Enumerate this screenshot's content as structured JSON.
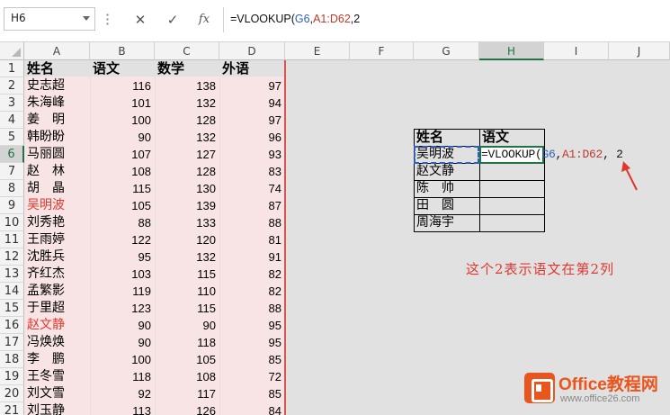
{
  "formula_bar": {
    "name_box": "H6",
    "cancel_glyph": "✕",
    "enter_glyph": "✓",
    "fx_label": "fx",
    "formula_prefix": "=VLOOKUP(",
    "formula_ref1": "G6",
    "formula_sep": ",",
    "formula_ref2": "A1:D62",
    "formula_suffix": ",2"
  },
  "columns": [
    "A",
    "B",
    "C",
    "D",
    "E",
    "F",
    "G",
    "H",
    "I",
    "J"
  ],
  "rows": [
    "1",
    "2",
    "3",
    "4",
    "5",
    "6",
    "7",
    "8",
    "9",
    "10",
    "11",
    "12",
    "13",
    "14",
    "15",
    "16",
    "17",
    "18",
    "19",
    "20",
    "21"
  ],
  "active_cell": {
    "col": "H",
    "row": "6"
  },
  "main_table": {
    "headers": [
      "姓名",
      "语文",
      "数学",
      "外语"
    ],
    "records": [
      {
        "name": "史志超",
        "yw": "116",
        "sx": "138",
        "wy": "97"
      },
      {
        "name": "朱海峰",
        "yw": "101",
        "sx": "132",
        "wy": "94"
      },
      {
        "name": "姜　明",
        "yw": "100",
        "sx": "128",
        "wy": "97"
      },
      {
        "name": "韩盼盼",
        "yw": "90",
        "sx": "132",
        "wy": "96"
      },
      {
        "name": "马丽圆",
        "yw": "107",
        "sx": "127",
        "wy": "93"
      },
      {
        "name": "赵　林",
        "yw": "108",
        "sx": "128",
        "wy": "83"
      },
      {
        "name": "胡　晶",
        "yw": "115",
        "sx": "130",
        "wy": "74"
      },
      {
        "name": "吴明波",
        "yw": "105",
        "sx": "139",
        "wy": "87"
      },
      {
        "name": "刘秀艳",
        "yw": "88",
        "sx": "133",
        "wy": "88"
      },
      {
        "name": "王雨婷",
        "yw": "122",
        "sx": "120",
        "wy": "81"
      },
      {
        "name": "沈胜兵",
        "yw": "95",
        "sx": "132",
        "wy": "91"
      },
      {
        "name": "齐红杰",
        "yw": "103",
        "sx": "115",
        "wy": "82"
      },
      {
        "name": "孟繁影",
        "yw": "119",
        "sx": "110",
        "wy": "82"
      },
      {
        "name": "于里超",
        "yw": "123",
        "sx": "115",
        "wy": "88"
      },
      {
        "name": "赵文静",
        "yw": "90",
        "sx": "90",
        "wy": "95"
      },
      {
        "name": "冯焕焕",
        "yw": "90",
        "sx": "118",
        "wy": "95"
      },
      {
        "name": "李　鹏",
        "yw": "100",
        "sx": "105",
        "wy": "85"
      },
      {
        "name": "王冬雪",
        "yw": "118",
        "sx": "108",
        "wy": "72"
      },
      {
        "name": "刘文雪",
        "yw": "92",
        "sx": "117",
        "wy": "85"
      },
      {
        "name": "刘玉静",
        "yw": "113",
        "sx": "126",
        "wy": "84"
      }
    ],
    "highlight_color": "#e0382f"
  },
  "lookup_table": {
    "headers": [
      "姓名",
      "语文"
    ],
    "names": [
      "吴明波",
      "赵文静",
      "陈　帅",
      "田　圆",
      "周海宇"
    ]
  },
  "cell_edit": {
    "prefix": "=VLOOKUP(",
    "ref1": "G6",
    "sep": ",",
    "ref2": "A1:D62",
    "suffix": ", 2"
  },
  "annotation": "这个2表示语文在第2列",
  "logo": {
    "title": "Office教程网",
    "url": "www.office26.com",
    "color": "#e8561e"
  }
}
